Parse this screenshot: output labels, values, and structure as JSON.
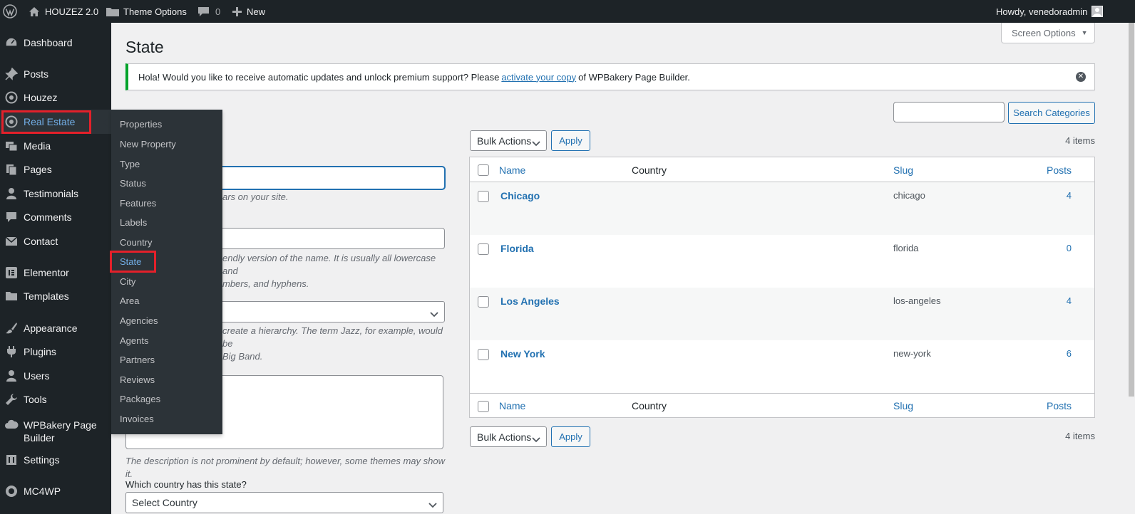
{
  "adminbar": {
    "site_name": "HOUZEZ 2.0",
    "theme_options": "Theme Options",
    "comments_count": "0",
    "new_label": "New",
    "howdy": "Howdy, venedoradmin"
  },
  "sidebar": {
    "items": [
      {
        "label": "Dashboard",
        "icon": "dashboard-icon"
      },
      {
        "label": "Posts",
        "icon": "pin-icon"
      },
      {
        "label": "Houzez",
        "icon": "houzez-icon"
      },
      {
        "label": "Real Estate",
        "icon": "location-icon"
      },
      {
        "label": "Media",
        "icon": "media-icon"
      },
      {
        "label": "Pages",
        "icon": "pages-icon"
      },
      {
        "label": "Testimonials",
        "icon": "user-icon"
      },
      {
        "label": "Comments",
        "icon": "comment-icon"
      },
      {
        "label": "Contact",
        "icon": "mail-icon"
      },
      {
        "label": "Elementor",
        "icon": "elementor-icon"
      },
      {
        "label": "Templates",
        "icon": "folder-icon"
      },
      {
        "label": "Appearance",
        "icon": "brush-icon"
      },
      {
        "label": "Plugins",
        "icon": "plugin-icon"
      },
      {
        "label": "Users",
        "icon": "users-icon"
      },
      {
        "label": "Tools",
        "icon": "wrench-icon"
      },
      {
        "label": "WPBakery Page Builder",
        "icon": "cloud-icon"
      },
      {
        "label": "Settings",
        "icon": "settings-icon"
      },
      {
        "label": "MC4WP",
        "icon": "mc4wp-icon"
      }
    ]
  },
  "submenu": {
    "items": [
      "Properties",
      "New Property",
      "Type",
      "Status",
      "Features",
      "Labels",
      "Country",
      "State",
      "City",
      "Area",
      "Agencies",
      "Agents",
      "Partners",
      "Reviews",
      "Packages",
      "Invoices"
    ],
    "current": "State"
  },
  "page": {
    "title": "State",
    "screen_options": "Screen Options"
  },
  "notice": {
    "text_before": "Hola! Would you like to receive automatic updates and unlock premium support? Please",
    "link_text": "activate your copy",
    "text_after": "of WPBakery Page Builder."
  },
  "form": {
    "name_help": "ars on your site.",
    "slug_help_1": "endly version of the name. It is usually all lowercase and",
    "slug_help_2": "mbers, and hyphens.",
    "parent_help_1": "create a hierarchy. The term Jazz, for example, would be",
    "parent_help_2": "Big Band.",
    "description_help": "The description is not prominent by default; however, some themes may show it.",
    "country_label": "Which country has this state?",
    "country_select": "Select Country"
  },
  "list": {
    "search_button": "Search Categories",
    "bulk_actions": "Bulk Actions",
    "apply": "Apply",
    "items_count": "4 items",
    "columns": {
      "name": "Name",
      "country": "Country",
      "slug": "Slug",
      "posts": "Posts"
    },
    "rows": [
      {
        "name": "Chicago",
        "country": "",
        "slug": "chicago",
        "posts": "4"
      },
      {
        "name": "Florida",
        "country": "",
        "slug": "florida",
        "posts": "0"
      },
      {
        "name": "Los Angeles",
        "country": "",
        "slug": "los-angeles",
        "posts": "4"
      },
      {
        "name": "New York",
        "country": "",
        "slug": "new-york",
        "posts": "6"
      }
    ]
  },
  "colors": {
    "adminbar_bg": "#1d2327",
    "link": "#2271b1",
    "current_menu": "#72aee6",
    "highlight_box": "#e4202a",
    "notice_border": "#00a32a"
  }
}
